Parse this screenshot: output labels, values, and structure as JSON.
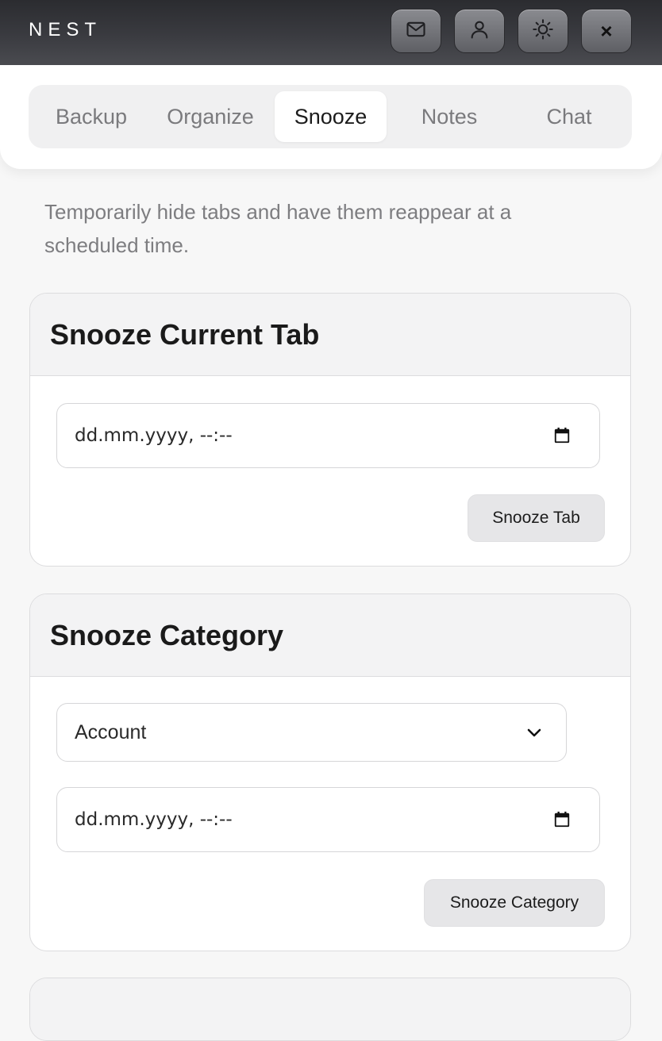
{
  "header": {
    "brand": "NEST",
    "buttons": [
      {
        "icon": "mail-icon"
      },
      {
        "icon": "user-icon"
      },
      {
        "icon": "sun-icon"
      },
      {
        "icon": "close-icon",
        "glyph": "×"
      }
    ]
  },
  "tabs": [
    {
      "label": "Backup",
      "active": false
    },
    {
      "label": "Organize",
      "active": false
    },
    {
      "label": "Snooze",
      "active": true
    },
    {
      "label": "Notes",
      "active": false
    },
    {
      "label": "Chat",
      "active": false
    }
  ],
  "description": "Temporarily hide tabs and have them reappear at a scheduled time.",
  "snooze_tab": {
    "title": "Snooze Current Tab",
    "datetime_placeholder": "dd.mm.yyyy, --:--",
    "button_label": "Snooze Tab"
  },
  "snooze_category": {
    "title": "Snooze Category",
    "selected_category": "Account",
    "datetime_placeholder": "dd.mm.yyyy, --:--",
    "button_label": "Snooze Category"
  },
  "colors": {
    "header_bg": "#3a3b40",
    "page_bg": "#f7f7f7",
    "card_head_bg": "#f3f3f4",
    "button_bg": "#e6e6e8"
  }
}
